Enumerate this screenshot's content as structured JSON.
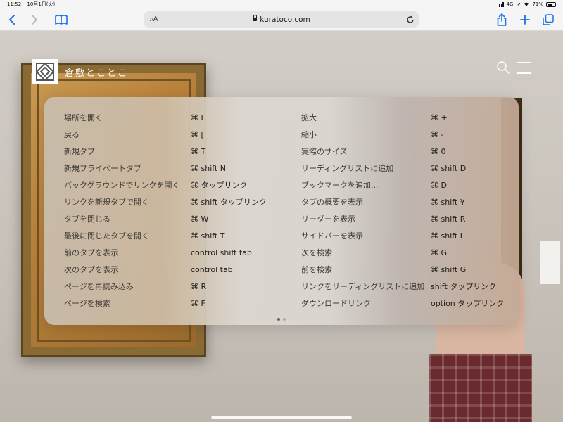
{
  "status_bar": {
    "time": "11:52",
    "date": "10月1日(火)",
    "network": "4G",
    "battery": "71%",
    "battery_level": 0.71
  },
  "toolbar": {
    "aa_label": "AA",
    "url": "kuratoco.com"
  },
  "site": {
    "brand_name": "倉敷とことこ"
  },
  "shortcuts": {
    "left": [
      {
        "name": "場所を開く",
        "keys": "⌘ L"
      },
      {
        "name": "戻る",
        "keys": "⌘ ["
      },
      {
        "name": "新規タブ",
        "keys": "⌘ T"
      },
      {
        "name": "新規プライベートタブ",
        "keys": "⌘ shift N"
      },
      {
        "name": "バックグラウンドでリンクを開く",
        "keys": "⌘ タップリンク"
      },
      {
        "name": "リンクを新規タブで開く",
        "keys": "⌘ shift タップリンク"
      },
      {
        "name": "タブを閉じる",
        "keys": "⌘ W"
      },
      {
        "name": "最後に閉じたタブを開く",
        "keys": "⌘ shift T"
      },
      {
        "name": "前のタブを表示",
        "keys": "control shift tab"
      },
      {
        "name": "次のタブを表示",
        "keys": "control tab"
      },
      {
        "name": "ページを再読み込み",
        "keys": "⌘ R"
      },
      {
        "name": "ページを検索",
        "keys": "⌘ F"
      }
    ],
    "right": [
      {
        "name": "拡大",
        "keys": "⌘ +"
      },
      {
        "name": "縮小",
        "keys": "⌘ -"
      },
      {
        "name": "実際のサイズ",
        "keys": "⌘ 0"
      },
      {
        "name": "リーディングリストに追加",
        "keys": "⌘ shift D"
      },
      {
        "name": "ブックマークを追加...",
        "keys": "⌘ D"
      },
      {
        "name": "タブの概要を表示",
        "keys": "⌘ shift ¥"
      },
      {
        "name": "リーダーを表示",
        "keys": "⌘ shift R"
      },
      {
        "name": "サイドバーを表示",
        "keys": "⌘ shift L"
      },
      {
        "name": "次を検索",
        "keys": "⌘ G"
      },
      {
        "name": "前を検索",
        "keys": "⌘ shift G"
      },
      {
        "name": "リンクをリーディングリストに追加",
        "keys": "shift タップリンク"
      },
      {
        "name": "ダウンロードリンク",
        "keys": "option タップリンク"
      }
    ]
  },
  "pager": {
    "page": 1,
    "pages": 2
  }
}
